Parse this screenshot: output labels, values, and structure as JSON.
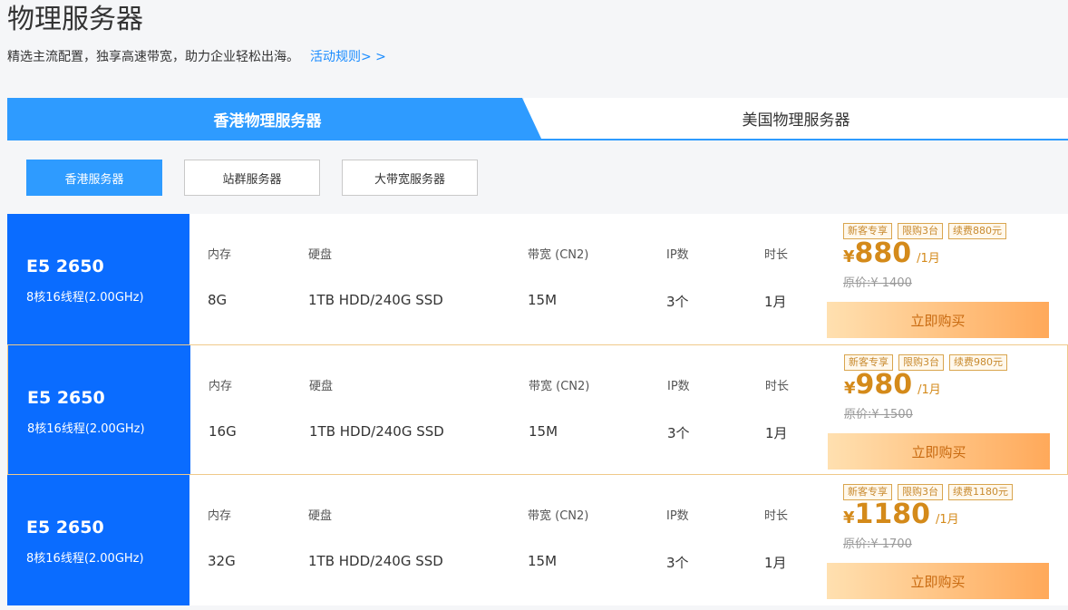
{
  "header": {
    "title": "物理服务器",
    "subtitle": "精选主流配置，独享高速带宽，助力企业轻松出海。",
    "rules_link": "活动规则> >"
  },
  "tabs": [
    {
      "label": "香港物理服务器",
      "active": true
    },
    {
      "label": "美国物理服务器",
      "active": false
    }
  ],
  "filters": [
    {
      "label": "香港服务器",
      "active": true
    },
    {
      "label": "站群服务器",
      "active": false
    },
    {
      "label": "大带宽服务器",
      "active": false
    }
  ],
  "columns": {
    "memory": "内存",
    "disk": "硬盘",
    "bandwidth": "带宽 (CN2)",
    "ip": "IP数",
    "duration": "时长"
  },
  "buy_label": "立即购买",
  "products": [
    {
      "cpu": "E5 2650",
      "spec": "8核16线程(2.00GHz)",
      "memory": "8G",
      "disk": "1TB HDD/240G SSD",
      "bandwidth": "15M",
      "ip": "3个",
      "duration": "1月",
      "tags": [
        "新客专享",
        "限购3台",
        "续费880元"
      ],
      "currency": "¥",
      "price": "880",
      "unit": "/1月",
      "original": "原价:¥ 1400"
    },
    {
      "cpu": "E5 2650",
      "spec": "8核16线程(2.00GHz)",
      "memory": "16G",
      "disk": "1TB HDD/240G SSD",
      "bandwidth": "15M",
      "ip": "3个",
      "duration": "1月",
      "tags": [
        "新客专享",
        "限购3台",
        "续费980元"
      ],
      "currency": "¥",
      "price": "980",
      "unit": "/1月",
      "original": "原价:¥ 1500"
    },
    {
      "cpu": "E5 2650",
      "spec": "8核16线程(2.00GHz)",
      "memory": "32G",
      "disk": "1TB HDD/240G SSD",
      "bandwidth": "15M",
      "ip": "3个",
      "duration": "1月",
      "tags": [
        "新客专享",
        "限购3台",
        "续费1180元"
      ],
      "currency": "¥",
      "price": "1180",
      "unit": "/1月",
      "original": "原价:¥ 1700"
    }
  ],
  "colors": {
    "accent": "#2e9bff",
    "cpu_block": "#0a6cff",
    "price": "#d48a1a"
  }
}
